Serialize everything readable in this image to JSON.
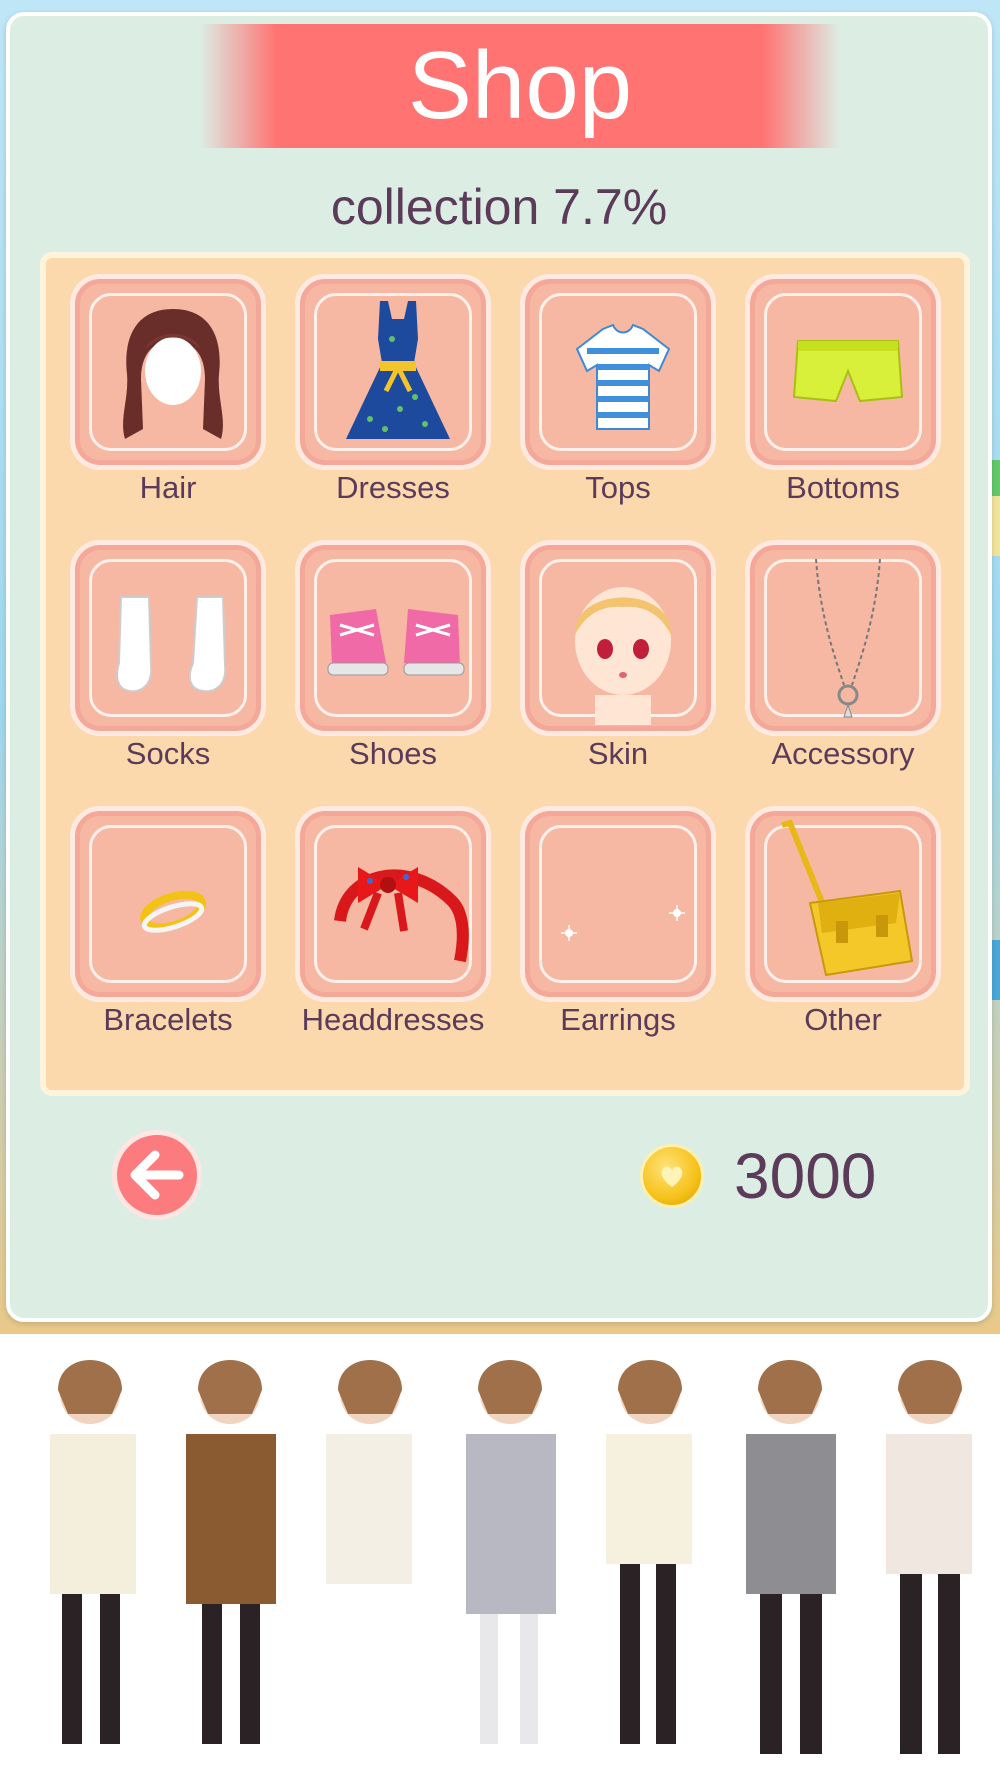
{
  "header": {
    "title": "Shop"
  },
  "collection_text": "collection 7.7%",
  "categories": [
    {
      "label": "Hair",
      "icon": "hair-icon"
    },
    {
      "label": "Dresses",
      "icon": "dress-icon"
    },
    {
      "label": "Tops",
      "icon": "top-icon"
    },
    {
      "label": "Bottoms",
      "icon": "shorts-icon"
    },
    {
      "label": "Socks",
      "icon": "socks-icon"
    },
    {
      "label": "Shoes",
      "icon": "shoes-icon"
    },
    {
      "label": "Skin",
      "icon": "face-icon"
    },
    {
      "label": "Accessory",
      "icon": "necklace-icon"
    },
    {
      "label": "Bracelets",
      "icon": "bracelet-icon"
    },
    {
      "label": "Headdresses",
      "icon": "headband-icon"
    },
    {
      "label": "Earrings",
      "icon": "earrings-icon"
    },
    {
      "label": "Other",
      "icon": "bag-icon"
    }
  ],
  "footer": {
    "back_icon": "arrow-left-icon",
    "coin_icon": "coin-icon",
    "coins": "3000"
  },
  "colors": {
    "banner": "#ff7373",
    "panel": "#dcede4",
    "grid_bg": "#fbd9ac",
    "tile": "#f6b8a3",
    "text": "#5b3a5a",
    "back_button": "#fb7b7f"
  }
}
